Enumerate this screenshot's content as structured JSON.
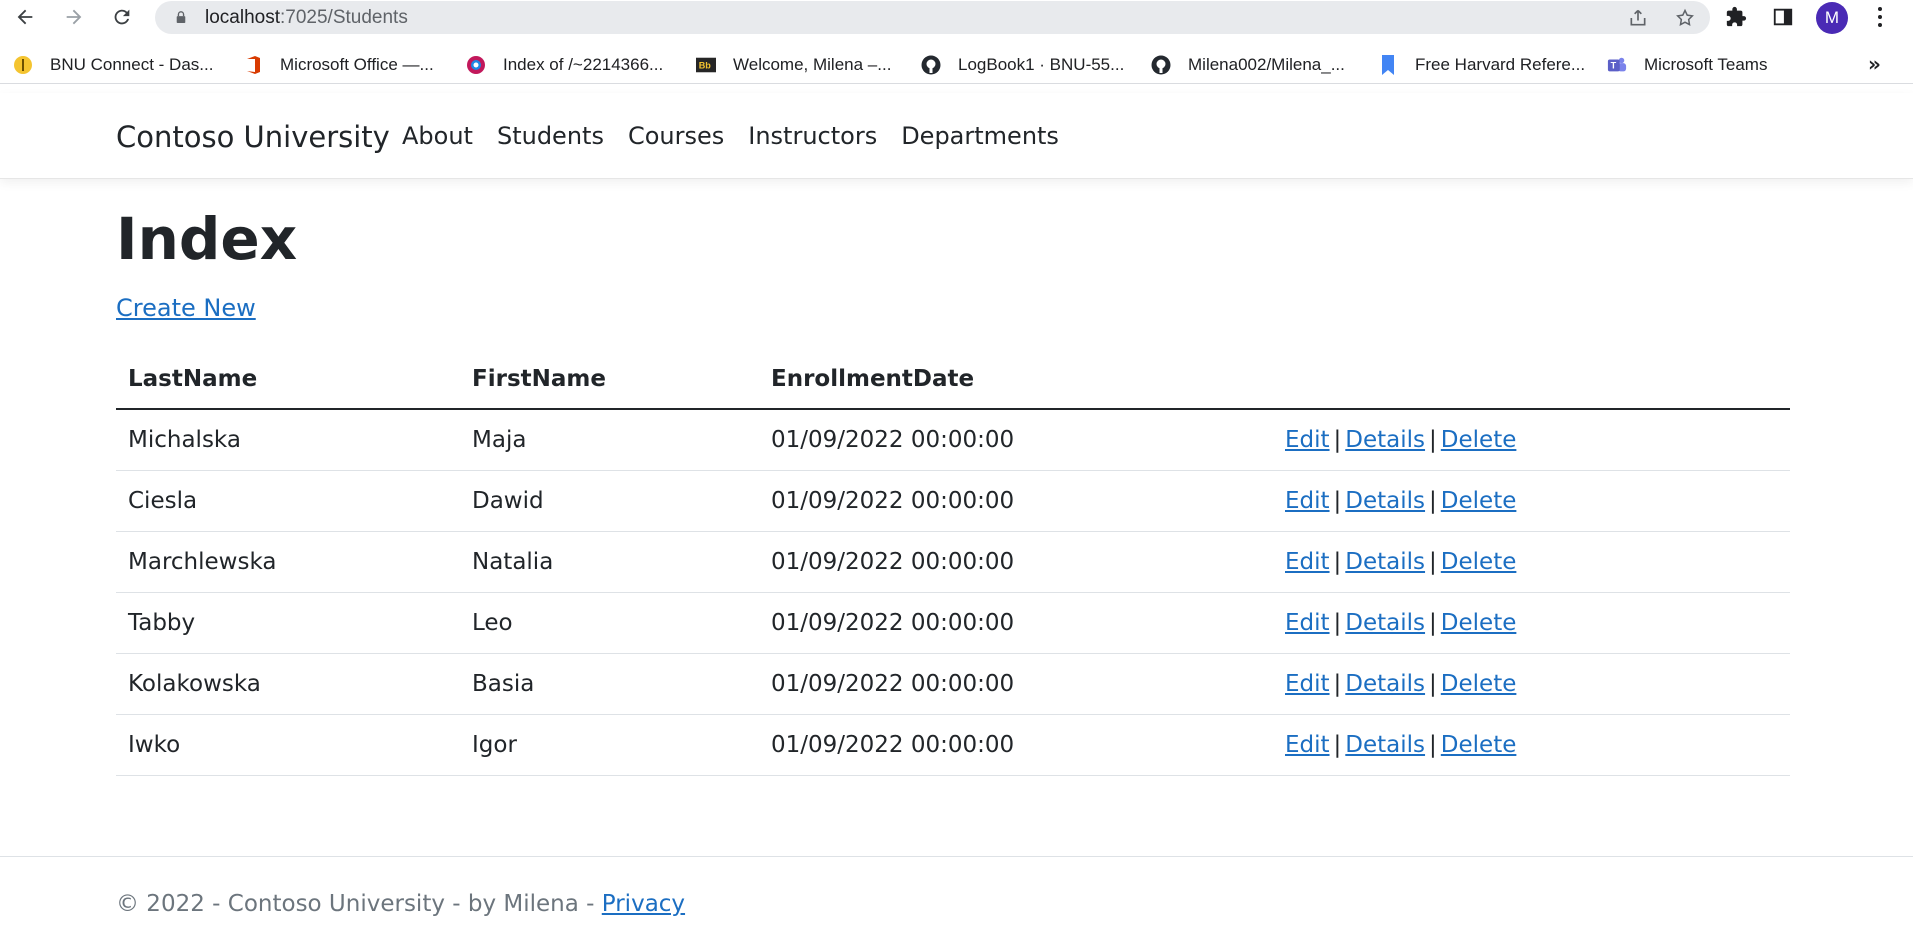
{
  "browser": {
    "url_host": "localhost",
    "url_path": ":7025/Students",
    "avatar_letter": "M",
    "bookmarks": [
      {
        "label": "BNU Connect - Das...",
        "icon": "bnu-connect-icon",
        "color": "#f4c430"
      },
      {
        "label": "Microsoft Office —...",
        "icon": "office-icon",
        "color": "#d83b01"
      },
      {
        "label": "Index of /~2214366...",
        "icon": "globe-icon",
        "color": "#c2185b"
      },
      {
        "label": "Welcome, Milena –...",
        "icon": "blackboard-icon",
        "color": "#262626"
      },
      {
        "label": "LogBook1 · BNU-55...",
        "icon": "github-icon",
        "color": "#24292f"
      },
      {
        "label": "Milena002/Milena_...",
        "icon": "github-icon",
        "color": "#24292f"
      },
      {
        "label": "Free Harvard Refere...",
        "icon": "bookmark-icon",
        "color": "#4285f4"
      },
      {
        "label": "Microsoft Teams",
        "icon": "teams-icon",
        "color": "#5b5fc7"
      }
    ],
    "more_label": "»"
  },
  "navbar": {
    "brand": "Contoso University",
    "links": [
      "About",
      "Students",
      "Courses",
      "Instructors",
      "Departments"
    ]
  },
  "main": {
    "title": "Index",
    "create_label": "Create New",
    "columns": [
      "LastName",
      "FirstName",
      "EnrollmentDate"
    ],
    "rows": [
      {
        "last": "Michalska",
        "first": "Maja",
        "date": "01/09/2022 00:00:00"
      },
      {
        "last": "Ciesla",
        "first": "Dawid",
        "date": "01/09/2022 00:00:00"
      },
      {
        "last": "Marchlewska",
        "first": "Natalia",
        "date": "01/09/2022 00:00:00"
      },
      {
        "last": "Tabby",
        "first": "Leo",
        "date": "01/09/2022 00:00:00"
      },
      {
        "last": "Kolakowska",
        "first": "Basia",
        "date": "01/09/2022 00:00:00"
      },
      {
        "last": "Iwko",
        "first": "Igor",
        "date": "01/09/2022 00:00:00"
      }
    ],
    "actions": {
      "edit": "Edit",
      "details": "Details",
      "delete": "Delete",
      "separator": "|"
    }
  },
  "footer": {
    "text": "© 2022 - Contoso University - by Milena - ",
    "privacy": "Privacy"
  },
  "colors": {
    "link": "#1b6ec2",
    "avatar": "#4a2ab5"
  }
}
